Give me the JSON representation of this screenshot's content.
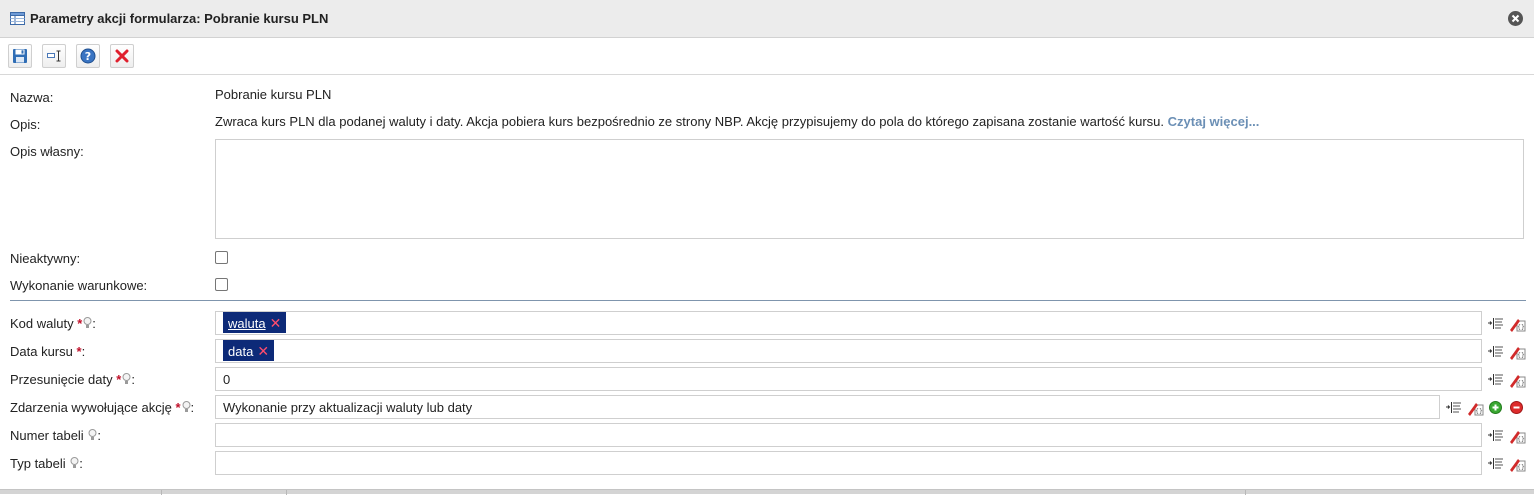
{
  "window": {
    "title": "Parametry akcji formularza: Pobranie kursu PLN",
    "title_icon": "table-icon",
    "close_icon": "close-circle-icon"
  },
  "toolbar": {
    "buttons": [
      {
        "name": "save-button",
        "icon": "floppy-disk-icon"
      },
      {
        "name": "field-button",
        "icon": "form-field-icon"
      },
      {
        "name": "help-button",
        "icon": "help-icon"
      },
      {
        "name": "delete-button",
        "icon": "red-x-icon"
      }
    ]
  },
  "form": {
    "name_label": "Nazwa:",
    "name_value": "Pobranie kursu PLN",
    "desc_label": "Opis:",
    "desc_value": "Zwraca kurs PLN dla podanej waluty i daty. Akcja pobiera kurs bezpośrednio ze strony NBP. Akcję przypisujemy do pola do którego zapisana zostanie wartość kursu.",
    "desc_link": "Czytaj więcej...",
    "own_desc_label": "Opis własny:",
    "own_desc_value": "",
    "inactive_label": "Nieaktywny:",
    "inactive_checked": false,
    "conditional_label": "Wykonanie warunkowe:",
    "conditional_checked": false
  },
  "params": [
    {
      "label": "Kod waluty",
      "required": true,
      "hint": true,
      "tag": "waluta",
      "value": ""
    },
    {
      "label": "Data kursu",
      "required": true,
      "hint": false,
      "tag": "data",
      "value": ""
    },
    {
      "label": "Przesunięcie daty",
      "required": true,
      "hint": true,
      "tag": "",
      "value": "0"
    },
    {
      "label": "Zdarzenia wywołujące akcję",
      "required": true,
      "hint": true,
      "tag": "",
      "value": "Wykonanie przy aktualizacji waluty lub daty"
    },
    {
      "label": "Numer tabeli",
      "required": false,
      "hint": true,
      "tag": "",
      "value": ""
    },
    {
      "label": "Typ tabeli",
      "required": false,
      "hint": true,
      "tag": "",
      "value": ""
    }
  ],
  "symbols": {
    "required_mark": "*",
    "colon": ":",
    "tag_remove": "✕"
  },
  "colors": {
    "tag_bg": "#0d2a78",
    "link": "#6b8fb5",
    "required": "#c0102a",
    "separator": "#7f95ad",
    "titlebar_bg": "#ececec"
  }
}
